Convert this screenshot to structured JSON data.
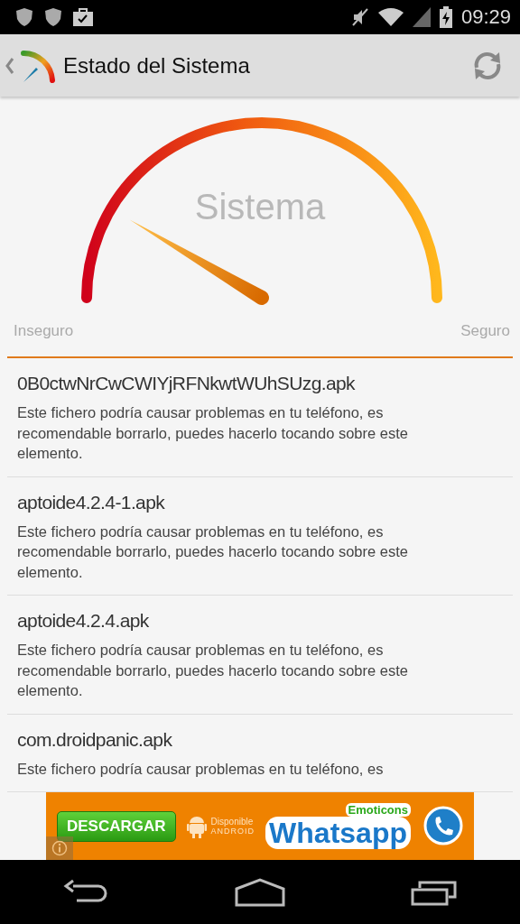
{
  "status_bar": {
    "time": "09:29"
  },
  "action_bar": {
    "title": "Estado del Sistema"
  },
  "gauge": {
    "title": "Sistema",
    "min_label": "Inseguro",
    "max_label": "Seguro"
  },
  "files": [
    {
      "name": "0B0ctwNrCwCWIYjRFNkwtWUhSUzg.apk",
      "description": "Este fichero podría causar problemas en tu teléfono, es recomendable borrarlo, puedes hacerlo tocando sobre este elemento."
    },
    {
      "name": "aptoide4.2.4-1.apk",
      "description": "Este fichero podría causar problemas en tu teléfono, es recomendable borrarlo, puedes hacerlo tocando sobre este elemento."
    },
    {
      "name": "aptoide4.2.4.apk",
      "description": "Este fichero podría causar problemas en tu teléfono, es recomendable borrarlo, puedes hacerlo tocando sobre este elemento."
    },
    {
      "name": "com.droidpanic.apk",
      "description": "Este fichero podría causar problemas en tu teléfono, es"
    }
  ],
  "ad": {
    "button": "DESCARGAR",
    "available": "Disponible",
    "platform": "ANDROID",
    "tagline": "Emoticons",
    "brand": "Whatsapp"
  }
}
